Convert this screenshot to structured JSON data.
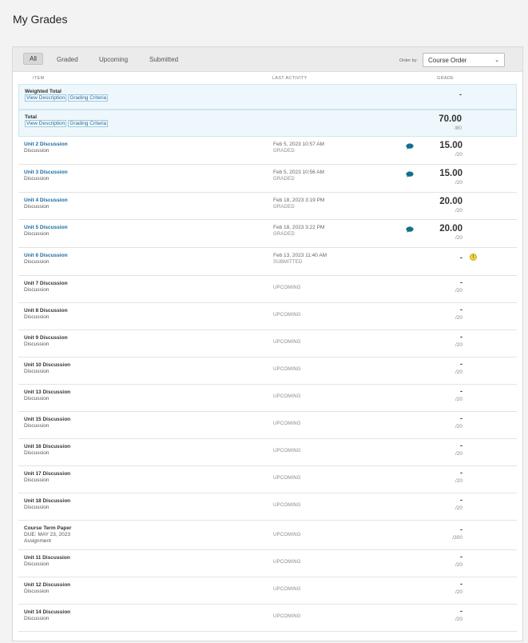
{
  "page": {
    "title": "My Grades"
  },
  "filters": {
    "tabs": [
      "All",
      "Graded",
      "Upcoming",
      "Submitted"
    ],
    "order_label": "Order by:",
    "order_value": "Course Order"
  },
  "columns": {
    "item": "ITEM",
    "activity": "LAST ACTIVITY",
    "grade": "GRADE"
  },
  "summary": [
    {
      "name": "Weighted Total",
      "link1": "View Description",
      "link2": "Grading Criteria",
      "grade": "-",
      "out_of": ""
    },
    {
      "name": "Total",
      "link1": "View Description",
      "link2": "Grading Criteria",
      "grade": "70.00",
      "out_of": "/80"
    }
  ],
  "rows": [
    {
      "name": "Unit 2 Discussion",
      "type": "Discussion",
      "date": "Feb 5, 2023 10:57 AM",
      "status": "GRADED",
      "grade": "15.00",
      "out_of": "/20",
      "comment": true,
      "link": true
    },
    {
      "name": "Unit 3 Discussion",
      "type": "Discussion",
      "date": "Feb 5, 2023 10:56 AM",
      "status": "GRADED",
      "grade": "15.00",
      "out_of": "/20",
      "comment": true,
      "link": true
    },
    {
      "name": "Unit 4 Discussion",
      "type": "Discussion",
      "date": "Feb 18, 2023 3:19 PM",
      "status": "GRADED",
      "grade": "20.00",
      "out_of": "/20",
      "comment": false,
      "link": true
    },
    {
      "name": "Unit 5 Discussion",
      "type": "Discussion",
      "date": "Feb 18, 2023 3:22 PM",
      "status": "GRADED",
      "grade": "20.00",
      "out_of": "/20",
      "comment": true,
      "link": true
    },
    {
      "name": "Unit 6 Discussion",
      "type": "Discussion",
      "date": "Feb 13, 2023 11:40 AM",
      "status": "SUBMITTED",
      "grade": "-",
      "out_of": "",
      "warn": true,
      "link": true
    },
    {
      "name": "Unit 7 Discussion",
      "type": "Discussion",
      "date": "",
      "status": "UPCOMING",
      "grade": "-",
      "out_of": "/20"
    },
    {
      "name": "Unit 8 Discussion",
      "type": "Discussion",
      "date": "",
      "status": "UPCOMING",
      "grade": "-",
      "out_of": "/20"
    },
    {
      "name": "Unit 9 Discussion",
      "type": "Discussion",
      "date": "",
      "status": "UPCOMING",
      "grade": "-",
      "out_of": "/20"
    },
    {
      "name": "Unit 10 Discussion",
      "type": "Discussion",
      "date": "",
      "status": "UPCOMING",
      "grade": "-",
      "out_of": "/20"
    },
    {
      "name": "Unit 13 Discussion",
      "type": "Discussion",
      "date": "",
      "status": "UPCOMING",
      "grade": "-",
      "out_of": "/20"
    },
    {
      "name": "Unit 15 Discussion",
      "type": "Discussion",
      "date": "",
      "status": "UPCOMING",
      "grade": "-",
      "out_of": "/20"
    },
    {
      "name": "Unit 16 Discussion",
      "type": "Discussion",
      "date": "",
      "status": "UPCOMING",
      "grade": "-",
      "out_of": "/20"
    },
    {
      "name": "Unit 17 Discussion",
      "type": "Discussion",
      "date": "",
      "status": "UPCOMING",
      "grade": "-",
      "out_of": "/20"
    },
    {
      "name": "Unit 18 Discussion",
      "type": "Discussion",
      "date": "",
      "status": "UPCOMING",
      "grade": "-",
      "out_of": "/20"
    },
    {
      "name": "Course Term Paper",
      "due": "DUE: MAY 23, 2023",
      "type": "Assignment",
      "date": "",
      "status": "UPCOMING",
      "grade": "-",
      "out_of": "/300"
    },
    {
      "name": "Unit 11 Discussion",
      "type": "Discussion",
      "date": "",
      "status": "UPCOMING",
      "grade": "-",
      "out_of": "/20"
    },
    {
      "name": "Unit 12 Discussion",
      "type": "Discussion",
      "date": "",
      "status": "UPCOMING",
      "grade": "-",
      "out_of": "/20"
    },
    {
      "name": "Unit 14 Discussion",
      "type": "Discussion",
      "date": "",
      "status": "UPCOMING",
      "grade": "-",
      "out_of": "/20"
    }
  ]
}
